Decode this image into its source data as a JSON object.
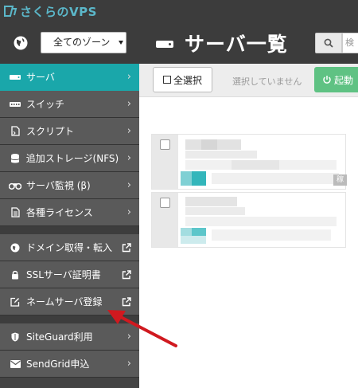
{
  "brand": {
    "logo_text": "さくらのVPS",
    "accent": "#1aa7aa"
  },
  "zone": {
    "selected": "全てのゾーン"
  },
  "sidebar": {
    "items": [
      {
        "label": "サーバ",
        "icon": "server-icon",
        "active": true
      },
      {
        "label": "スイッチ",
        "icon": "switch-icon"
      },
      {
        "label": "スクリプト",
        "icon": "script-icon"
      },
      {
        "label": "追加ストレージ(NFS)",
        "icon": "storage-icon"
      },
      {
        "label": "サーバ監視 (β)",
        "icon": "binoculars-icon"
      },
      {
        "label": "各種ライセンス",
        "icon": "license-icon"
      }
    ],
    "external_items": [
      {
        "label": "ドメイン取得・転入",
        "icon": "globe-icon"
      },
      {
        "label": "SSLサーバ証明書",
        "icon": "lock-icon"
      },
      {
        "label": "ネームサーバ登録",
        "icon": "edit-icon"
      }
    ],
    "bottom_items": [
      {
        "label": "SiteGuard利用",
        "icon": "shield-icon"
      },
      {
        "label": "SendGrid申込",
        "icon": "envelope-icon"
      }
    ]
  },
  "main": {
    "title": "サーバ一覧",
    "search_placeholder": "検",
    "toolbar": {
      "select_all": "全選択",
      "status": "選択していません",
      "start_label": "起動"
    },
    "cards": [
      {
        "badge": "稼中"
      },
      {
        "badge": ""
      }
    ]
  }
}
